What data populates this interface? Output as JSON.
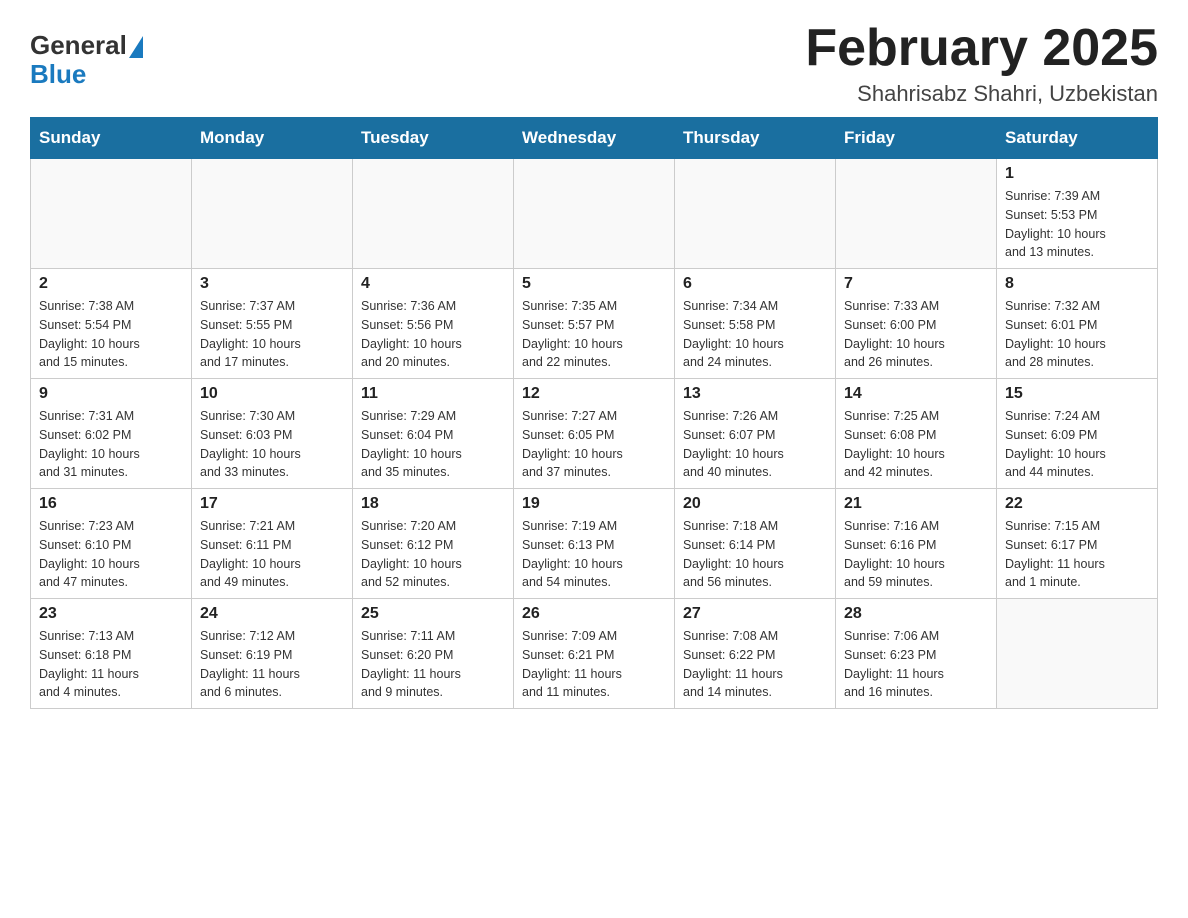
{
  "header": {
    "logo_general": "General",
    "logo_blue": "Blue",
    "month_title": "February 2025",
    "subtitle": "Shahrisabz Shahri, Uzbekistan"
  },
  "days_of_week": [
    "Sunday",
    "Monday",
    "Tuesday",
    "Wednesday",
    "Thursday",
    "Friday",
    "Saturday"
  ],
  "weeks": [
    {
      "days": [
        {
          "num": "",
          "info": ""
        },
        {
          "num": "",
          "info": ""
        },
        {
          "num": "",
          "info": ""
        },
        {
          "num": "",
          "info": ""
        },
        {
          "num": "",
          "info": ""
        },
        {
          "num": "",
          "info": ""
        },
        {
          "num": "1",
          "info": "Sunrise: 7:39 AM\nSunset: 5:53 PM\nDaylight: 10 hours\nand 13 minutes."
        }
      ]
    },
    {
      "days": [
        {
          "num": "2",
          "info": "Sunrise: 7:38 AM\nSunset: 5:54 PM\nDaylight: 10 hours\nand 15 minutes."
        },
        {
          "num": "3",
          "info": "Sunrise: 7:37 AM\nSunset: 5:55 PM\nDaylight: 10 hours\nand 17 minutes."
        },
        {
          "num": "4",
          "info": "Sunrise: 7:36 AM\nSunset: 5:56 PM\nDaylight: 10 hours\nand 20 minutes."
        },
        {
          "num": "5",
          "info": "Sunrise: 7:35 AM\nSunset: 5:57 PM\nDaylight: 10 hours\nand 22 minutes."
        },
        {
          "num": "6",
          "info": "Sunrise: 7:34 AM\nSunset: 5:58 PM\nDaylight: 10 hours\nand 24 minutes."
        },
        {
          "num": "7",
          "info": "Sunrise: 7:33 AM\nSunset: 6:00 PM\nDaylight: 10 hours\nand 26 minutes."
        },
        {
          "num": "8",
          "info": "Sunrise: 7:32 AM\nSunset: 6:01 PM\nDaylight: 10 hours\nand 28 minutes."
        }
      ]
    },
    {
      "days": [
        {
          "num": "9",
          "info": "Sunrise: 7:31 AM\nSunset: 6:02 PM\nDaylight: 10 hours\nand 31 minutes."
        },
        {
          "num": "10",
          "info": "Sunrise: 7:30 AM\nSunset: 6:03 PM\nDaylight: 10 hours\nand 33 minutes."
        },
        {
          "num": "11",
          "info": "Sunrise: 7:29 AM\nSunset: 6:04 PM\nDaylight: 10 hours\nand 35 minutes."
        },
        {
          "num": "12",
          "info": "Sunrise: 7:27 AM\nSunset: 6:05 PM\nDaylight: 10 hours\nand 37 minutes."
        },
        {
          "num": "13",
          "info": "Sunrise: 7:26 AM\nSunset: 6:07 PM\nDaylight: 10 hours\nand 40 minutes."
        },
        {
          "num": "14",
          "info": "Sunrise: 7:25 AM\nSunset: 6:08 PM\nDaylight: 10 hours\nand 42 minutes."
        },
        {
          "num": "15",
          "info": "Sunrise: 7:24 AM\nSunset: 6:09 PM\nDaylight: 10 hours\nand 44 minutes."
        }
      ]
    },
    {
      "days": [
        {
          "num": "16",
          "info": "Sunrise: 7:23 AM\nSunset: 6:10 PM\nDaylight: 10 hours\nand 47 minutes."
        },
        {
          "num": "17",
          "info": "Sunrise: 7:21 AM\nSunset: 6:11 PM\nDaylight: 10 hours\nand 49 minutes."
        },
        {
          "num": "18",
          "info": "Sunrise: 7:20 AM\nSunset: 6:12 PM\nDaylight: 10 hours\nand 52 minutes."
        },
        {
          "num": "19",
          "info": "Sunrise: 7:19 AM\nSunset: 6:13 PM\nDaylight: 10 hours\nand 54 minutes."
        },
        {
          "num": "20",
          "info": "Sunrise: 7:18 AM\nSunset: 6:14 PM\nDaylight: 10 hours\nand 56 minutes."
        },
        {
          "num": "21",
          "info": "Sunrise: 7:16 AM\nSunset: 6:16 PM\nDaylight: 10 hours\nand 59 minutes."
        },
        {
          "num": "22",
          "info": "Sunrise: 7:15 AM\nSunset: 6:17 PM\nDaylight: 11 hours\nand 1 minute."
        }
      ]
    },
    {
      "days": [
        {
          "num": "23",
          "info": "Sunrise: 7:13 AM\nSunset: 6:18 PM\nDaylight: 11 hours\nand 4 minutes."
        },
        {
          "num": "24",
          "info": "Sunrise: 7:12 AM\nSunset: 6:19 PM\nDaylight: 11 hours\nand 6 minutes."
        },
        {
          "num": "25",
          "info": "Sunrise: 7:11 AM\nSunset: 6:20 PM\nDaylight: 11 hours\nand 9 minutes."
        },
        {
          "num": "26",
          "info": "Sunrise: 7:09 AM\nSunset: 6:21 PM\nDaylight: 11 hours\nand 11 minutes."
        },
        {
          "num": "27",
          "info": "Sunrise: 7:08 AM\nSunset: 6:22 PM\nDaylight: 11 hours\nand 14 minutes."
        },
        {
          "num": "28",
          "info": "Sunrise: 7:06 AM\nSunset: 6:23 PM\nDaylight: 11 hours\nand 16 minutes."
        },
        {
          "num": "",
          "info": ""
        }
      ]
    }
  ]
}
